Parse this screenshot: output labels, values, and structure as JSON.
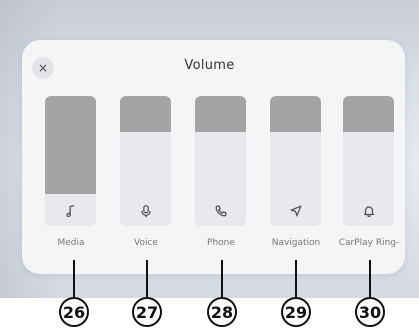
{
  "dialog": {
    "title": "Volume",
    "close_icon": "close-icon",
    "close_glyph": "×"
  },
  "sliders": [
    {
      "label": "Media",
      "icon": "music-note-icon",
      "level": 0.75
    },
    {
      "label": "Voice",
      "icon": "microphone-icon",
      "level": 0.28
    },
    {
      "label": "Phone",
      "icon": "phone-icon",
      "level": 0.28
    },
    {
      "label": "Navigation",
      "icon": "navigation-arrow-icon",
      "level": 0.28
    },
    {
      "label": "CarPlay Ring-",
      "icon": "bell-icon",
      "level": 0.28
    }
  ],
  "callouts": [
    "26",
    "27",
    "28",
    "29",
    "30"
  ]
}
